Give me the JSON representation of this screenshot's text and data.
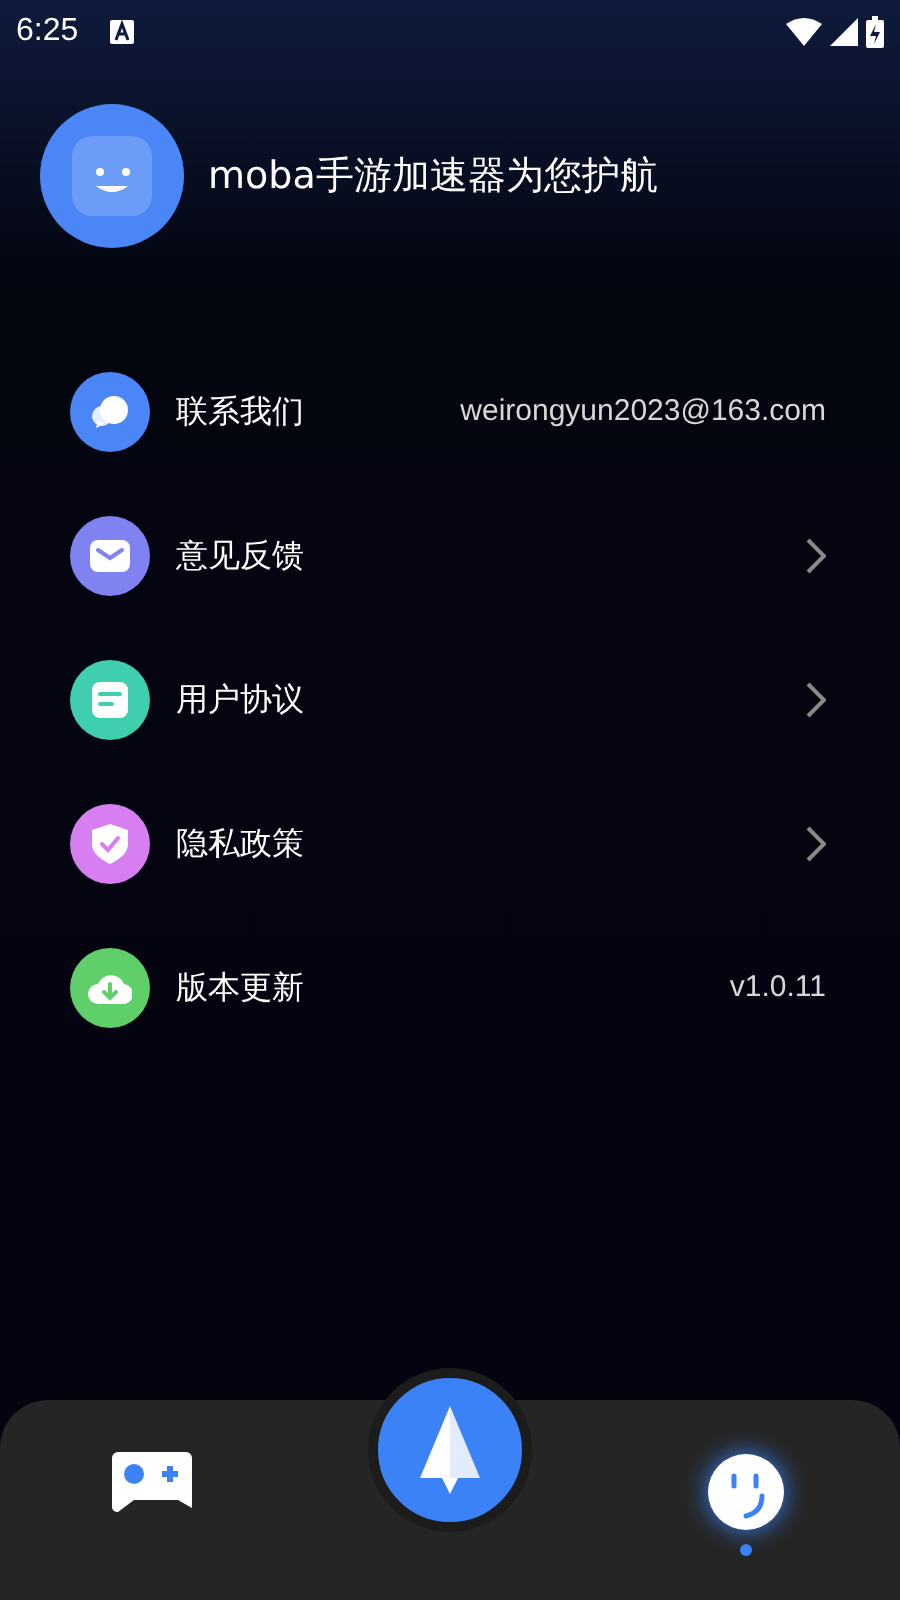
{
  "status_bar": {
    "time": "6:25"
  },
  "header": {
    "title": "moba手游加速器为您护航"
  },
  "menu": [
    {
      "label": "联系我们",
      "kind": "value",
      "value": "weirongyun2023@163.com",
      "color": "#4a86f5"
    },
    {
      "label": "意见反馈",
      "kind": "link",
      "color": "#7f82f0"
    },
    {
      "label": "用户协议",
      "kind": "link",
      "color": "#3fcfae"
    },
    {
      "label": "隐私政策",
      "kind": "link",
      "color": "#d77ef0"
    },
    {
      "label": "版本更新",
      "kind": "value",
      "value": "v1.0.11",
      "color": "#5fcf6a"
    }
  ],
  "bottom_nav": [
    {
      "selected": false
    },
    {
      "selected": true
    }
  ]
}
